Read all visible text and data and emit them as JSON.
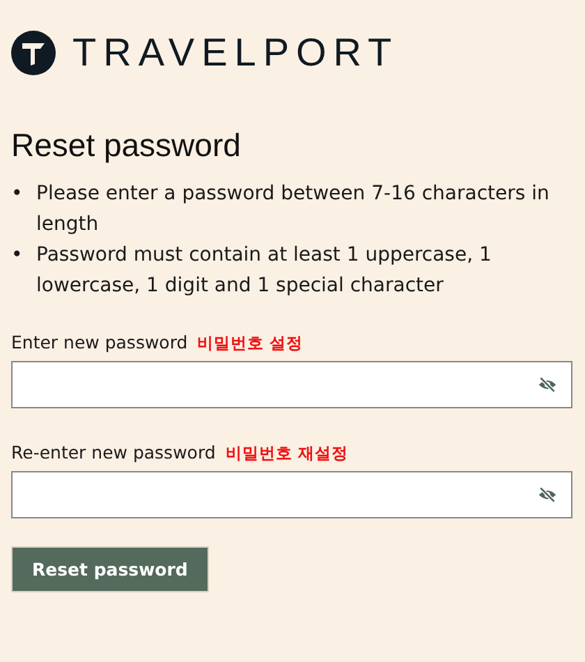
{
  "logo": {
    "text": "TRAVELPORT"
  },
  "title": "Reset password",
  "rules": [
    {
      "bullet": "•",
      "text": "Please enter a password between 7-16 characters in length"
    },
    {
      "bullet": "•",
      "text": "Password must contain at least 1 uppercase, 1 lowercase, 1 digit and 1 special character"
    }
  ],
  "fields": [
    {
      "label": "Enter new password",
      "note": "비밀번호 설정"
    },
    {
      "label": "Re-enter new password",
      "note": "비밀번호 재설정"
    }
  ],
  "button": "Reset password"
}
